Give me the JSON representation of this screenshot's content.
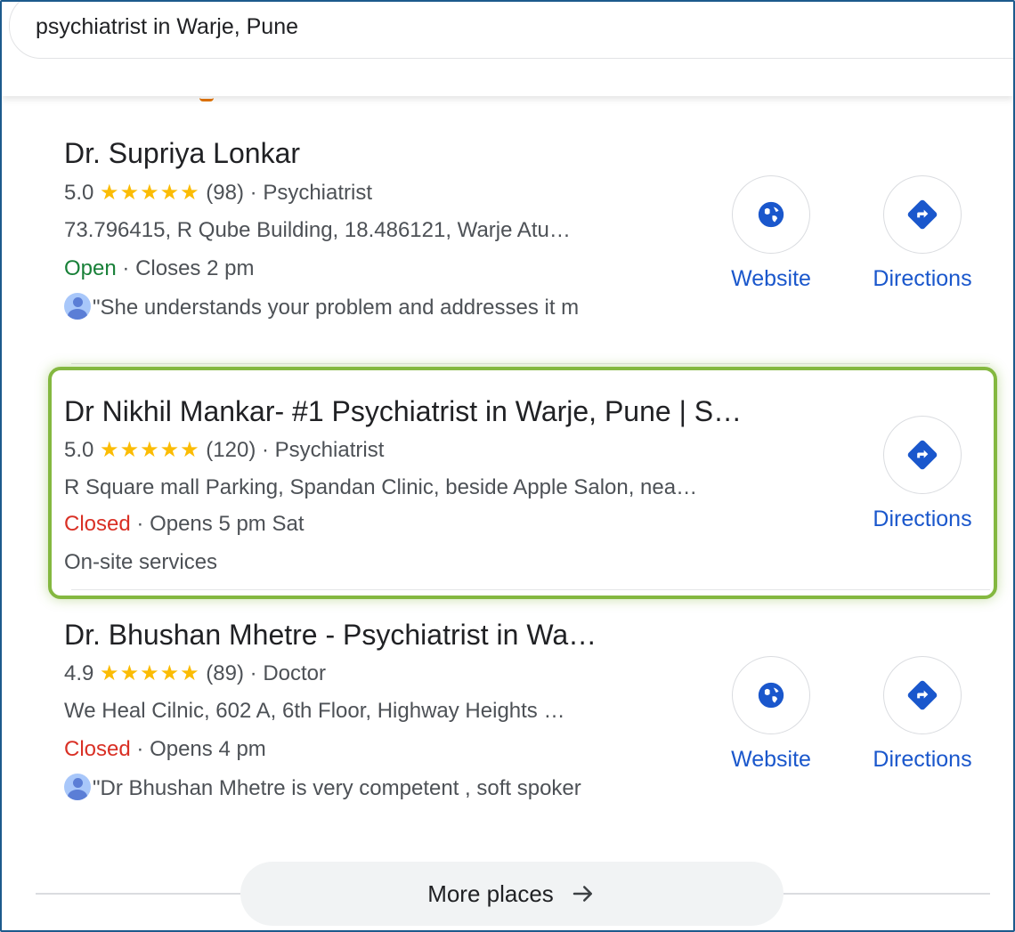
{
  "search": {
    "query": "psychiatrist in Warje, Pune"
  },
  "listings": [
    {
      "name": "Dr. Supriya Lonkar",
      "rating": "5.0",
      "stars": "★★★★★",
      "reviews": "(98)",
      "category": "Psychiatrist",
      "address": "73.796415, R Qube Building, 18.486121, Warje Atu…",
      "status": "Open",
      "hours": "Closes 2 pm",
      "review": "\"She understands your problem and addresses it m",
      "website_label": "Website",
      "directions_label": "Directions"
    },
    {
      "name": "Dr Nikhil Mankar- #1 Psychiatrist in Warje, Pune | S…",
      "rating": "5.0",
      "stars": "★★★★★",
      "reviews": "(120)",
      "category": "Psychiatrist",
      "address": "R Square mall Parking, Spandan Clinic, beside Apple Salon, nea…",
      "status": "Closed",
      "hours": "Opens 5 pm Sat",
      "extra": "On-site services",
      "directions_label": "Directions"
    },
    {
      "name": "Dr. Bhushan Mhetre - Psychiatrist in Wa…",
      "rating": "4.9",
      "stars": "★★★★★",
      "reviews": "(89)",
      "category": "Doctor",
      "address": "We Heal Cilnic, 602 A, 6th Floor, Highway Heights …",
      "status": "Closed",
      "hours": "Opens 4 pm",
      "review": "\"Dr Bhushan Mhetre is very competent , soft spoker",
      "website_label": "Website",
      "directions_label": "Directions"
    }
  ],
  "more_places": {
    "label": "More places"
  },
  "colors": {
    "open": "#188038",
    "closed": "#d93025",
    "link": "#1a57cc",
    "star": "#fbbc04",
    "highlight": "#84b840"
  },
  "icons": [
    "globe-icon",
    "directions-icon",
    "arrow-right-icon",
    "reviewer-avatar-icon"
  ]
}
